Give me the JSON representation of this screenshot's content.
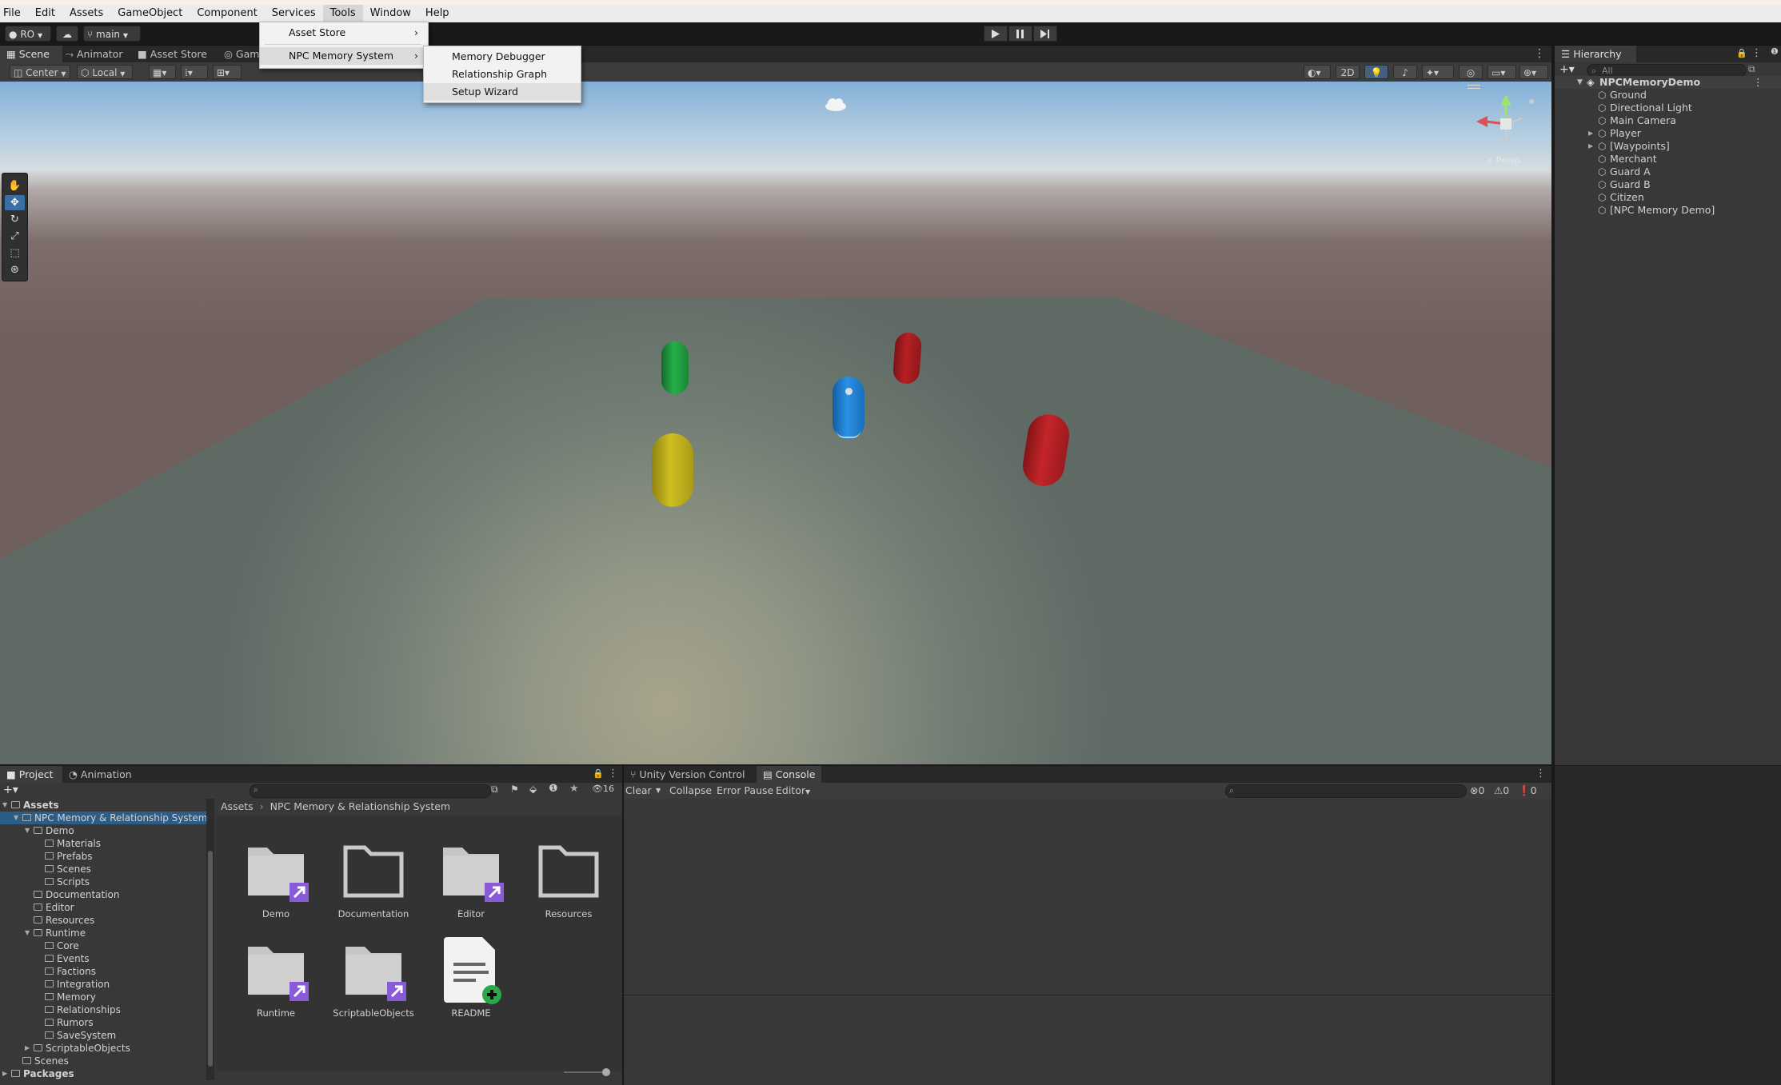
{
  "menubar": {
    "items": [
      "File",
      "Edit",
      "Assets",
      "GameObject",
      "Component",
      "Services",
      "Tools",
      "Window",
      "Help"
    ]
  },
  "toolbar": {
    "account": "RO",
    "branch": "main"
  },
  "tools_menu": {
    "items": [
      "Asset Store",
      "NPC Memory System"
    ]
  },
  "npc_submenu": {
    "items": [
      "Memory Debugger",
      "Relationship Graph",
      "Setup Wizard"
    ]
  },
  "scene_tabs": [
    "Scene",
    "Animator",
    "Asset Store",
    "Gam"
  ],
  "scene_toolbar": {
    "pivot": "Center",
    "space": "Local",
    "mode_2d": "2D"
  },
  "gizmo": {
    "persp_label": "< Persp"
  },
  "hierarchy": {
    "title": "Hierarchy",
    "search_placeholder": "All",
    "scene": "NPCMemoryDemo",
    "objects": [
      "Ground",
      "Directional Light",
      "Main Camera",
      "Player",
      "[Waypoints]",
      "Merchant",
      "Guard A",
      "Guard B",
      "Citizen",
      "[NPC Memory Demo]"
    ]
  },
  "project": {
    "tabs": [
      "Project",
      "Animation"
    ],
    "hidden_count": "16",
    "breadcrumb": [
      "Assets",
      "NPC Memory & Relationship System"
    ],
    "tree": [
      {
        "label": "Assets",
        "depth": 0
      },
      {
        "label": "NPC Memory & Relationship System",
        "depth": 1
      },
      {
        "label": "Demo",
        "depth": 2
      },
      {
        "label": "Materials",
        "depth": 3
      },
      {
        "label": "Prefabs",
        "depth": 3
      },
      {
        "label": "Scenes",
        "depth": 3
      },
      {
        "label": "Scripts",
        "depth": 3
      },
      {
        "label": "Documentation",
        "depth": 2
      },
      {
        "label": "Editor",
        "depth": 2
      },
      {
        "label": "Resources",
        "depth": 2
      },
      {
        "label": "Runtime",
        "depth": 2
      },
      {
        "label": "Core",
        "depth": 3
      },
      {
        "label": "Events",
        "depth": 3
      },
      {
        "label": "Factions",
        "depth": 3
      },
      {
        "label": "Integration",
        "depth": 3
      },
      {
        "label": "Memory",
        "depth": 3
      },
      {
        "label": "Relationships",
        "depth": 3
      },
      {
        "label": "Rumors",
        "depth": 3
      },
      {
        "label": "SaveSystem",
        "depth": 3
      },
      {
        "label": "ScriptableObjects",
        "depth": 2
      },
      {
        "label": "Scenes",
        "depth": 1
      },
      {
        "label": "Packages",
        "depth": 0
      }
    ],
    "assets": [
      "Demo",
      "Documentation",
      "Editor",
      "Resources",
      "Runtime",
      "ScriptableObjects",
      "README"
    ]
  },
  "console": {
    "tabs": [
      "Unity Version Control",
      "Console"
    ],
    "buttons": {
      "clear": "Clear",
      "collapse": "Collapse",
      "error_pause": "Error Pause",
      "editor": "Editor"
    },
    "counts": {
      "errors": "0",
      "warnings": "0",
      "infos": "0"
    }
  },
  "colors": {
    "selection": "#2c5d87",
    "capsule_green": "#1f9a3e",
    "capsule_red": "#b52025",
    "capsule_blue": "#1e7fd4",
    "capsule_yellow": "#c2b11c"
  }
}
